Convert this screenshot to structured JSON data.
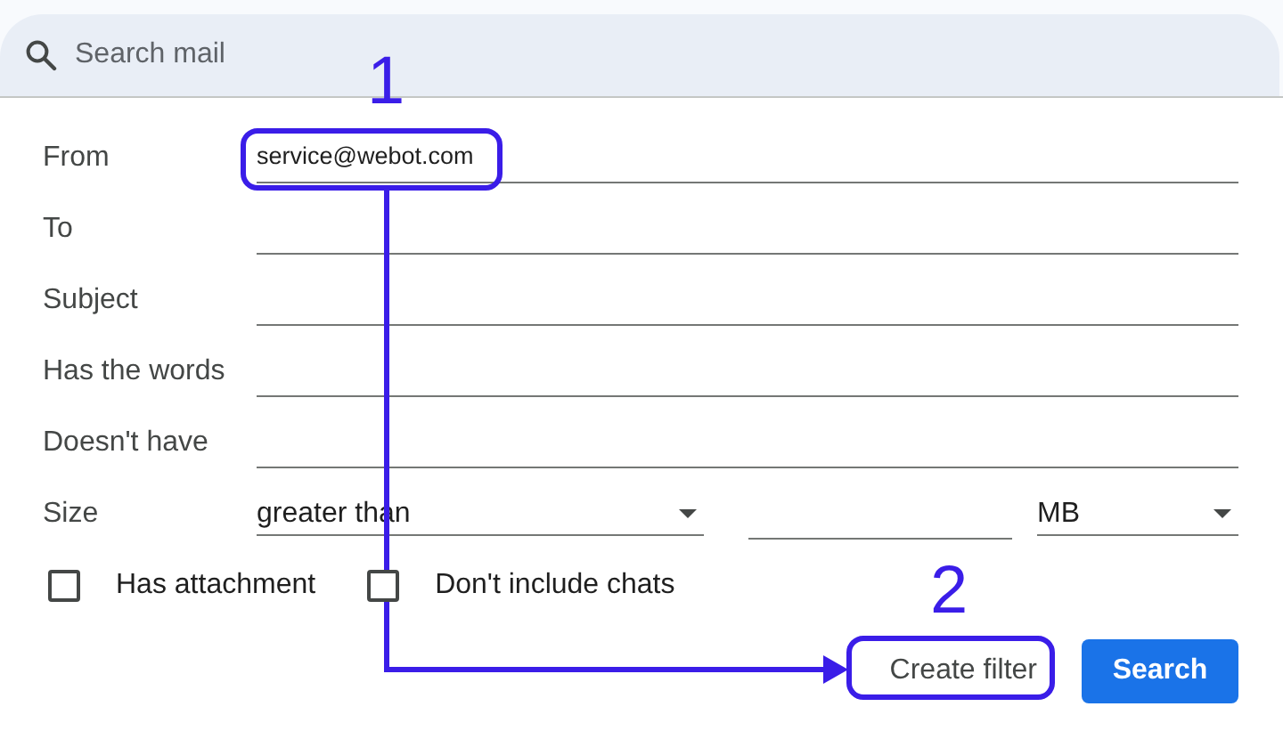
{
  "search": {
    "placeholder": "Search mail"
  },
  "fields": [
    {
      "label": "From",
      "value": "service@webot.com"
    },
    {
      "label": "To"
    },
    {
      "label": "Subject"
    },
    {
      "label": "Has the words"
    },
    {
      "label": "Doesn't have"
    }
  ],
  "size": {
    "label": "Size",
    "operator": "greater than",
    "unit": "MB"
  },
  "options": [
    {
      "label": "Has attachment",
      "checked": false
    },
    {
      "label": "Don't include chats",
      "checked": false
    }
  ],
  "buttons": [
    {
      "label": "Create filter",
      "kind": "secondary"
    },
    {
      "label": "Search",
      "kind": "primary"
    }
  ],
  "annotations": [
    {
      "label": "1"
    },
    {
      "label": "2"
    }
  ]
}
